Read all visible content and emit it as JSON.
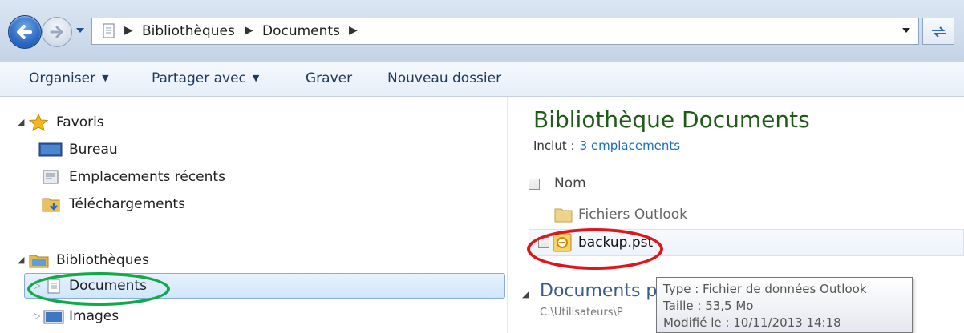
{
  "address_bar": {
    "crumbs": [
      "Bibliothèques",
      "Documents"
    ]
  },
  "toolbar": {
    "organize": "Organiser",
    "share": "Partager avec",
    "burn": "Graver",
    "new_folder": "Nouveau dossier"
  },
  "nav": {
    "favorites": {
      "label": "Favoris",
      "items": [
        "Bureau",
        "Emplacements récents",
        "Téléchargements"
      ]
    },
    "libraries": {
      "label": "Bibliothèques",
      "items": [
        "Documents",
        "Images"
      ]
    }
  },
  "content": {
    "title": "Bibliothèque Documents",
    "includes_label": "Inclut :",
    "includes_link": "3 emplacements",
    "column_name": "Nom",
    "files": [
      "Fichiers Outlook",
      "backup.pst"
    ],
    "group_title": "Documents pu",
    "group_path": "C:\\Utilisateurs\\P"
  },
  "tooltip": {
    "type": "Type : Fichier de données Outlook",
    "size": "Taille : 53,5 Mo",
    "modified": "Modifié le : 10/11/2013 14:18"
  },
  "icons": {
    "back": "back-arrow-icon",
    "forward": "forward-arrow-icon",
    "refresh": "refresh-icon",
    "favorites": "star-icon",
    "desktop": "desktop-icon",
    "recent": "recent-places-icon",
    "downloads": "downloads-folder-icon",
    "libraries": "library-icon",
    "documents": "documents-icon",
    "images": "images-icon",
    "folder": "folder-icon",
    "pst": "outlook-pst-icon"
  },
  "colors": {
    "title_green": "#1e5b14",
    "link_blue": "#1a6ec2",
    "annotation_green": "#13a84a",
    "annotation_red": "#e0151c"
  }
}
